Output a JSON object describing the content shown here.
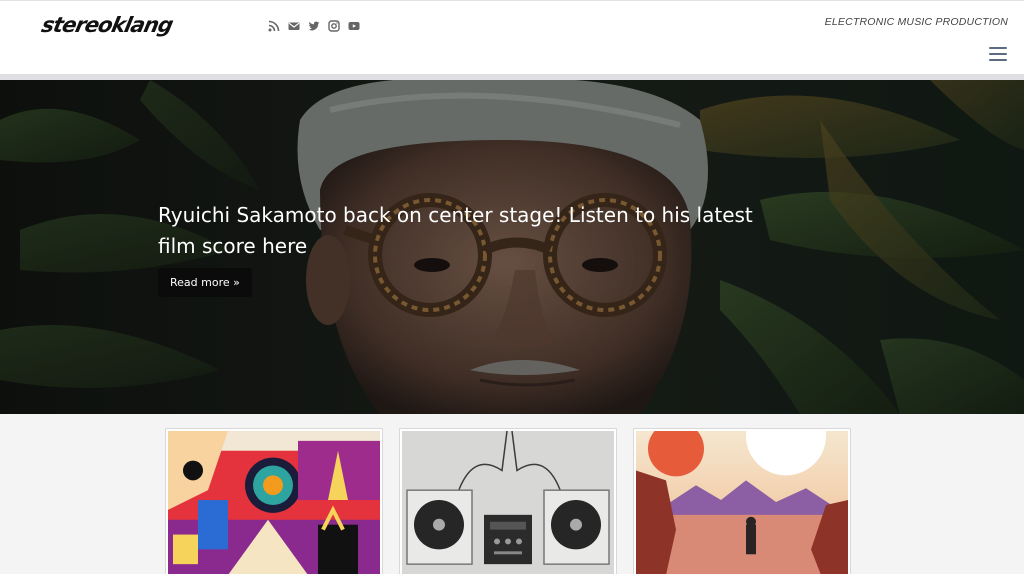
{
  "header": {
    "logo_text": "stereoklang",
    "tagline": "ELECTRONIC MUSIC PRODUCTION",
    "social_icons": [
      "rss-icon",
      "mail-icon",
      "twitter-icon",
      "instagram-icon",
      "youtube-icon"
    ],
    "menu_icon": "hamburger-menu-icon"
  },
  "hero": {
    "title": "Ryuichi Sakamoto back on center stage! Listen to his latest film score here",
    "read_more": "Read more »"
  },
  "cards": [
    {
      "image": "colorful-retro-illustration"
    },
    {
      "image": "turntables-and-mixer"
    },
    {
      "image": "astronaut-desert-landscape"
    }
  ],
  "colors": {
    "header_bg": "#ffffff",
    "hero_overlay": "#1a1c1a",
    "button_bg": "#0b0b0b",
    "menu_icon": "#5b6b80",
    "page_bg": "#f4f4f4"
  }
}
